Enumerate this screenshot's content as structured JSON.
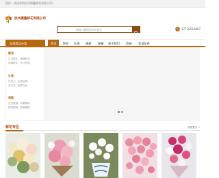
{
  "topbar": {
    "welcome": "您好，欢迎来到杭州德鑫鲜花有限公司！"
  },
  "header": {
    "logo_name": "杭州德鑫鲜花有限公司",
    "search_placeholder": "请输入要搜索的关键字",
    "phone": "17710510807"
  },
  "nav": {
    "category_button": "全部商品分类",
    "items": [
      "首页",
      "鲜花",
      "礼物",
      "蛋糕",
      "绿植",
      "关于我们",
      "商城",
      "花语花卉"
    ]
  },
  "categories": [
    {
      "title": "鲜花",
      "links": [
        [
          "生日鲜花",
          "爱情鲜花"
        ],
        [
          "祝福鲜花",
          "开业花篮"
        ]
      ]
    },
    {
      "title": "礼物",
      "links": [
        [
          "巧克力",
          "毛绒玩具"
        ],
        [
          "永生花",
          "创意礼品"
        ]
      ]
    },
    {
      "title": "蛋糕",
      "links": [
        [
          "生日蛋糕",
          "水果蛋糕"
        ],
        [
          "鲜奶蛋糕",
          "慕斯蛋糕"
        ]
      ]
    }
  ],
  "section": {
    "title": "鲜花专区",
    "more": "查看更多 >"
  },
  "colors": {
    "brand": "#b8690f",
    "brand_dark": "#8b4a12",
    "logo_text": "#b0470f"
  },
  "icons": {
    "phone": "phone-icon",
    "search": "search-icon",
    "logo": "flower-logo-icon"
  }
}
